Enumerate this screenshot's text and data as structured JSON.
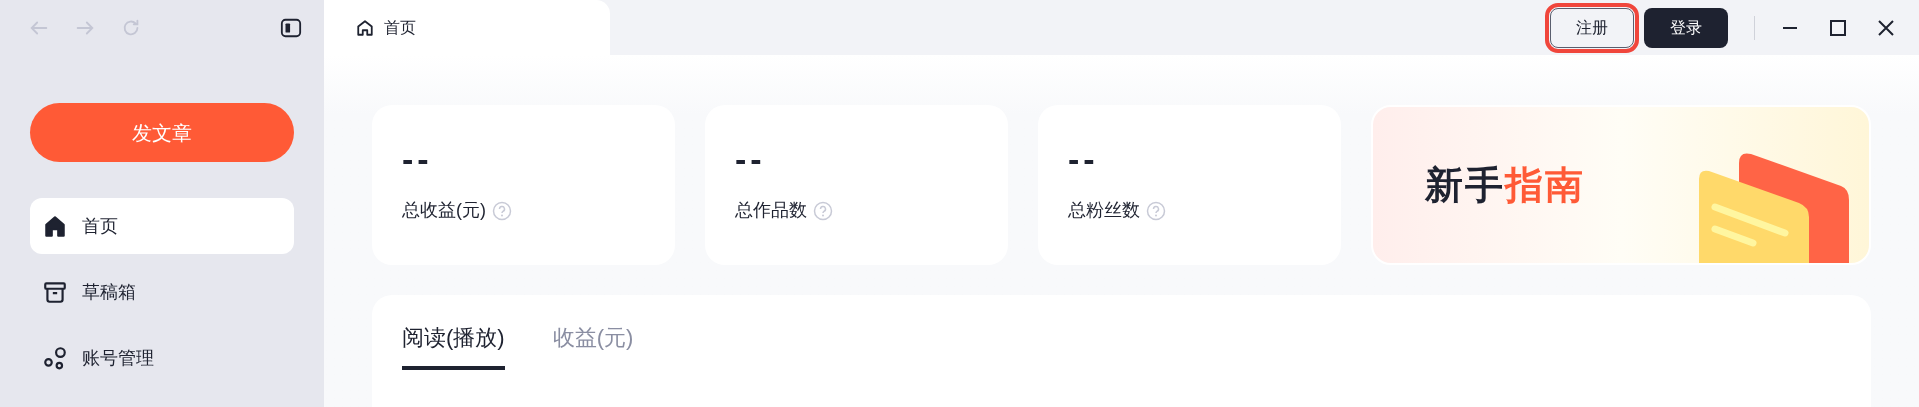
{
  "tab": {
    "label": "首页"
  },
  "header_buttons": [
    {
      "label": "注册",
      "kind": "outline",
      "highlighted": true
    },
    {
      "label": "登录",
      "kind": "dark",
      "highlighted": false
    }
  ],
  "sidebar": {
    "publish_button": "发文章",
    "items": [
      {
        "label": "首页",
        "kind": "home",
        "selected": true
      },
      {
        "label": "草稿箱",
        "kind": "archive",
        "selected": false
      },
      {
        "label": "账号管理",
        "kind": "circles",
        "selected": false
      }
    ]
  },
  "stats": [
    {
      "value": "--",
      "label": "总收益(元)"
    },
    {
      "value": "--",
      "label": "总作品数"
    },
    {
      "value": "--",
      "label": "总粉丝数"
    }
  ],
  "guide": {
    "title": [
      {
        "text": "新手",
        "kind": "plain"
      },
      {
        "text": "指南",
        "kind": "accent"
      }
    ]
  },
  "panel_tabs": [
    {
      "label": "阅读(播放)",
      "selected": true
    },
    {
      "label": "收益(元)",
      "selected": false
    }
  ]
}
